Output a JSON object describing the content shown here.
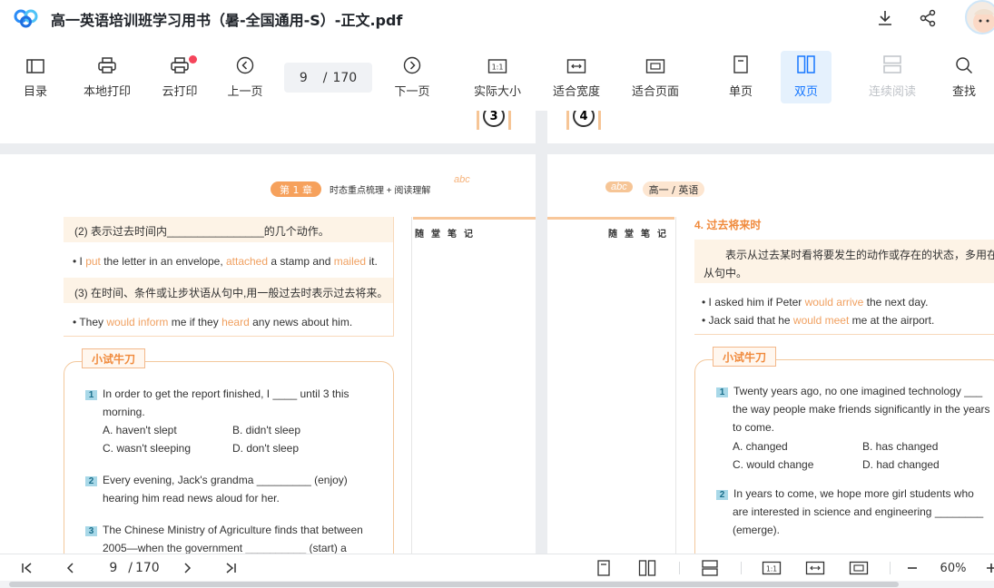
{
  "window": {
    "title": "高一英语培训班学习用书（暑-全国通用-S）-正文.pdf"
  },
  "toolbar": {
    "toc": "目录",
    "local_print": "本地打印",
    "cloud_print": "云打印",
    "prev_page": "上一页",
    "current_page": "9",
    "page_sep": "/",
    "total_pages": "170",
    "next_page": "下一页",
    "actual_size": "实际大小",
    "fit_width": "适合宽度",
    "fit_page": "适合页面",
    "single_page": "单页",
    "double_page": "双页",
    "continuous": "连续阅读",
    "search": "查找",
    "size_glyph": "1:1"
  },
  "left_page": {
    "page_number_top": "3",
    "header_pill": "第 1 章",
    "header_title": "时态重点梳理 + 阅读理解",
    "rule2": "(2) 表示过去时间内________________的几个动作。",
    "ex1_parts": [
      "• I ",
      "put",
      " the letter in an envelope, ",
      "attached",
      " a stamp and ",
      "mailed",
      " it."
    ],
    "rule3": "(3) 在时间、条件或让步状语从句中,用一般过去时表示过去将来。",
    "ex2_parts": [
      "• They ",
      "would inform",
      " me if they ",
      "heard",
      " any news about him."
    ],
    "notes_title": "随堂笔记",
    "try_tag": "小试牛刀",
    "q1_num": "1",
    "q1_line1": "In order to get the report finished, I ____ until 3 this",
    "q1_line2": "morning.",
    "q1_a": "A. haven't slept",
    "q1_b": "B. didn't sleep",
    "q1_c": "C. wasn't sleeping",
    "q1_d": "D. don't sleep",
    "q2_num": "2",
    "q2_line1": "Every evening, Jack's grandma _________ (enjoy)",
    "q2_line2": "hearing him read news aloud for her.",
    "q3_num": "3",
    "q3_line1": "The Chinese Ministry of Agriculture finds that between",
    "q3_line2": "2005—when the government __________ (start) a"
  },
  "right_page": {
    "page_number_top": "4",
    "header_pill": "高一 / 英语",
    "notes_title": "随堂笔记",
    "section_title": "4. 过去将来时",
    "desc_line1": "表示从过去某时看将要发生的动作或存在的状态，多用在宾语",
    "desc_line2": "从句中。",
    "ex1_parts": [
      "• I asked him if Peter ",
      "would arrive",
      " the next day."
    ],
    "ex2_parts": [
      "• Jack said that he ",
      "would meet",
      " me at the airport."
    ],
    "try_tag": "小试牛刀",
    "q1_num": "1",
    "q1_line1": "Twenty years ago, no one imagined technology ___",
    "q1_line2": "the way people make friends significantly in the years",
    "q1_line3": "to come.",
    "q1_a": "A. changed",
    "q1_b": "B. has changed",
    "q1_c": "C. would change",
    "q1_d": "D. had changed",
    "q2_num": "2",
    "q2_line1": "In years to come, we hope more girl students who",
    "q2_line2": "are interested in science and engineering ________",
    "q2_line3": "(emerge)."
  },
  "statusbar": {
    "current_page": "9",
    "page_sep": "/",
    "total_pages": "170",
    "zoom": "60%",
    "size_glyph": "1:1"
  }
}
